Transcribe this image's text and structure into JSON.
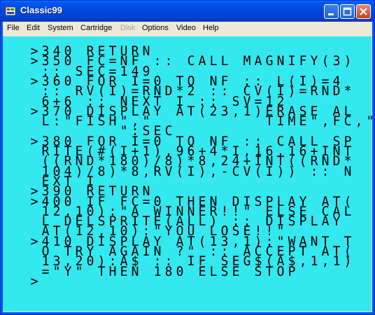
{
  "window": {
    "title": "Classic99",
    "icon": "classic99-app-icon",
    "controls": [
      "minimize",
      "maximize",
      "close"
    ]
  },
  "menu": [
    {
      "label": "File",
      "enabled": true
    },
    {
      "label": "Edit",
      "enabled": true
    },
    {
      "label": "System",
      "enabled": true
    },
    {
      "label": "Cartridge",
      "enabled": true
    },
    {
      "label": "Disk",
      "enabled": false
    },
    {
      "label": "Options",
      "enabled": true
    },
    {
      "label": "Video",
      "enabled": true
    },
    {
      "label": "Help",
      "enabled": true
    }
  ],
  "screen": {
    "background": "#34e8f0",
    "text_color": "#000000",
    "lines": [
      "  >340 RETURN",
      "  >350 FC=NF :: CALL MAGNIFY(3)",
      "   :: SEC=149",
      "  >360 FOR I=0 TO NF :: L(I)=4",
      "   :: RV(I)=RND*2 :: CV(I)=RND*",
      "   6+6 :: NEXT I :: SV=12",
      "  >370 DISPLAY AT(23,1)ERASE AL",
      "   L:\"FISH\",\"          TIME\",FC,\"",
      "          \":SEC",
      "  >380 FOR I=0 TO NF :: CALL SP",
      "   RITE(#(I+1),96+4*I,16,16+INT",
      "   ((RND*180)/8)*8,24+INT((RND*",
      "   104)/8)*8,RV(I),-CV(I)) :: N",
      "   EXT I",
      "  >390 RETURN",
      "  >400 IF FC=0 THEN DISPLAY AT(",
      "   12,10):\"A WINNER!!\" ELSE CAL",
      "   L DELSPRITE(ALL) :: DISPLAY",
      "   AT(12,10):\"YOU LOSE!!\"",
      "  >410 DISPLAY AT(13,1):\"WANT T",
      "   O TRY AGAIN ?\" :: ACCEPT AT(",
      "   13,20):A$ :: IF SEG$(A$,1,1)",
      "   =\"Y\" THEN 180 ELSE STOP",
      "  >"
    ]
  }
}
